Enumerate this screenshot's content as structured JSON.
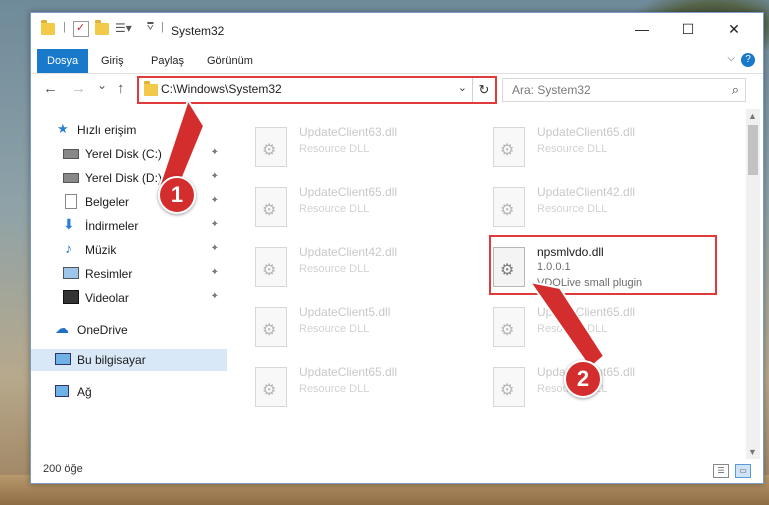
{
  "window": {
    "title": "System32",
    "controls": {
      "minimize": "—",
      "maximize": "☐",
      "close": "✕"
    }
  },
  "ribbon": {
    "tabs": [
      {
        "label": "Dosya",
        "active": true
      },
      {
        "label": "Giriş",
        "active": false
      },
      {
        "label": "Paylaş",
        "active": false
      },
      {
        "label": "Görünüm",
        "active": false
      }
    ],
    "help": "?",
    "expand": "⌵"
  },
  "nav": {
    "back": "←",
    "forward": "→",
    "recent": "⌄",
    "up": "↑",
    "address": "C:\\Windows\\System32",
    "address_dropdown": "⌄",
    "refresh": "↻",
    "search_placeholder": "Ara: System32",
    "search_icon": "⌕"
  },
  "sidebar": {
    "items": [
      {
        "label": "Hızlı erişim",
        "icon": "star-icon",
        "pinned": false
      },
      {
        "label": "Yerel Disk (C:)",
        "icon": "drive-icon",
        "pinned": true
      },
      {
        "label": "Yerel Disk (D:)",
        "icon": "drive-icon",
        "pinned": true
      },
      {
        "label": "Belgeler",
        "icon": "documents-icon",
        "pinned": true
      },
      {
        "label": "İndirmeler",
        "icon": "download-icon",
        "pinned": true
      },
      {
        "label": "Müzik",
        "icon": "music-icon",
        "pinned": true
      },
      {
        "label": "Resimler",
        "icon": "pictures-icon",
        "pinned": true
      },
      {
        "label": "Videolar",
        "icon": "videos-icon",
        "pinned": true
      },
      {
        "label": "OneDrive",
        "icon": "onedrive-icon",
        "pinned": false
      },
      {
        "label": "Bu bilgisayar",
        "icon": "computer-icon",
        "pinned": false,
        "selected": true
      },
      {
        "label": "Ağ",
        "icon": "network-icon",
        "pinned": false
      }
    ],
    "pin_glyph": "📌"
  },
  "files": {
    "left": [
      {
        "name": "UpdateClient63.dll",
        "desc": "Resource DLL"
      },
      {
        "name": "UpdateClient65.dll",
        "desc": "Resource DLL"
      },
      {
        "name": "UpdateClient42.dll",
        "desc": "Resource DLL"
      },
      {
        "name": "UpdateClient5.dll",
        "desc": "Resource DLL"
      },
      {
        "name": "UpdateClient65.dll",
        "desc": "Resource DLL"
      }
    ],
    "right": [
      {
        "name": "UpdateClient65.dll",
        "desc": "Resource DLL"
      },
      {
        "name": "UpdateClient42.dll",
        "desc": "Resource DLL"
      },
      {
        "name": "npsmlvdo.dll",
        "version": "1.0.0.1",
        "desc": "VDOLive small plugin",
        "highlight": true
      },
      {
        "name": "UpdateClient65.dll",
        "desc": "Resource DLL"
      },
      {
        "name": "UpdateClient65.dll",
        "desc": "Resource DLL"
      }
    ]
  },
  "status": {
    "count": "200 öğe"
  },
  "annotations": {
    "step1": "1",
    "step2": "2",
    "color": "#d42d2d"
  }
}
